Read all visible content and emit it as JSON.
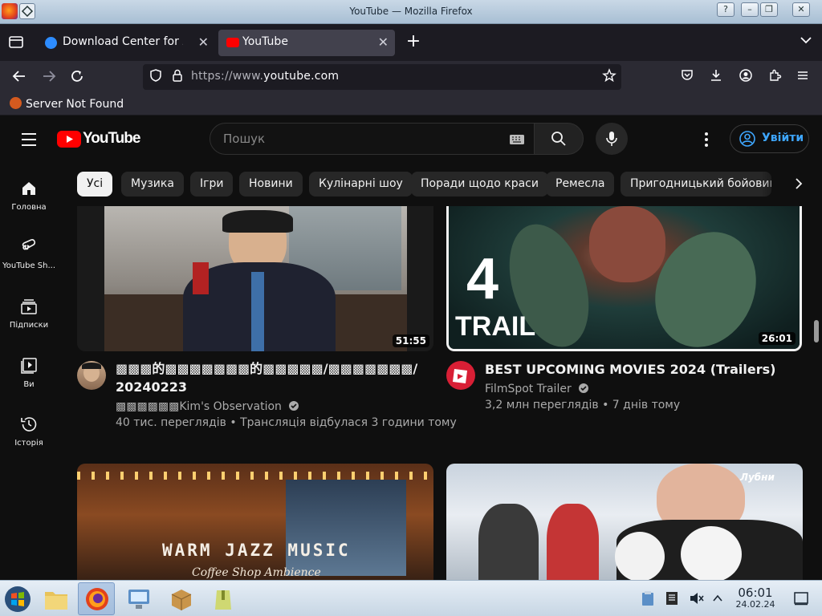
{
  "window": {
    "title": "YouTube — Mozilla Firefox",
    "help_label": "?",
    "min_label": "–",
    "max_label": "❐",
    "close_label": "✕"
  },
  "tabs": [
    {
      "label": "Download Center for Zoom",
      "close": "✕"
    },
    {
      "label": "YouTube",
      "close": "✕"
    }
  ],
  "newtab_label": "+",
  "nav": {
    "url_prefix": "https://www.",
    "url_host": "youtube.com"
  },
  "bookmarks": [
    {
      "label": "Server Not Found"
    }
  ],
  "youtube": {
    "logo_text": "YouTube",
    "search_placeholder": "Пошук",
    "signin_label": "Увійти",
    "chips": [
      "Усі",
      "Музика",
      "Ігри",
      "Новини",
      "Кулінарні шоу",
      "Поради щодо краси",
      "Ремесла",
      "Пригодницький бойовик"
    ],
    "sidebar": [
      {
        "label": "Головна",
        "icon": "home-icon"
      },
      {
        "label": "YouTube Sh...",
        "icon": "shorts-icon"
      },
      {
        "label": "Підписки",
        "icon": "subscriptions-icon"
      },
      {
        "label": "Ви",
        "icon": "you-icon"
      },
      {
        "label": "Історія",
        "icon": "history-icon"
      }
    ],
    "videos": [
      {
        "title_line1": "▩▩▩的▩▩▩▩▩▩▩的▩▩▩▩▩/▩▩▩▩▩▩▩/",
        "title_line2": "20240223",
        "channel": "▩▩▩▩▩▩Kim's Observation",
        "meta": "40 тис. переглядів • Трансляція відбулася 3 години тому",
        "duration": "51:55"
      },
      {
        "title_line1": "BEST UPCOMING MOVIES 2024 (Trailers)",
        "title_line2": "",
        "channel": "FilmSpot Trailer",
        "meta": "3,2 млн переглядів • 7 днів тому",
        "duration": "26:01",
        "thumb_text_number": "4",
        "thumb_text_word": "TRAIL"
      },
      {
        "thumb_text": "WARM JAZZ MUSIC",
        "thumb_subtext": "Coffee Shop Ambience"
      },
      {
        "thumb_logo_text": "Лубни"
      }
    ]
  },
  "taskbar": {
    "time": "06:01",
    "date": "24.02.24"
  },
  "colors": {
    "yt_red": "#ff0000",
    "yt_bg": "#0f0f0f",
    "chip_bg": "#272727",
    "signin_blue": "#3ea6ff",
    "firefox_toolbar": "#2b2a33"
  }
}
